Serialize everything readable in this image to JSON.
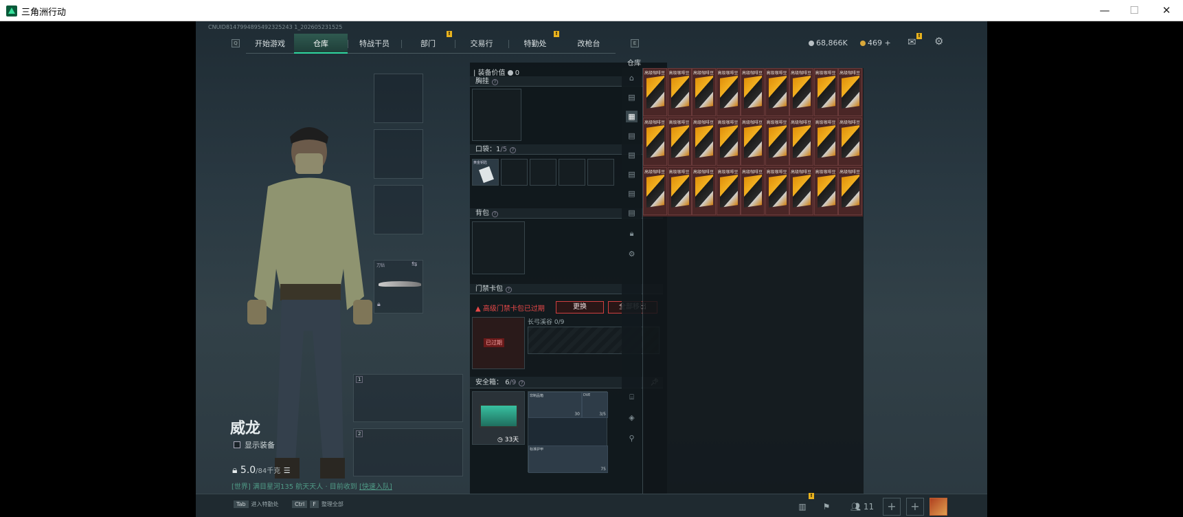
{
  "window": {
    "title": "三角洲行动",
    "minimize": "—",
    "maximize": "☐",
    "close": "✕"
  },
  "uid": "CNUID8147994895492325243 1_202605231525",
  "nav": {
    "left_key": "Q",
    "right_key": "E",
    "items": [
      {
        "label": "开始游戏",
        "active": false
      },
      {
        "label": "仓库",
        "active": true
      },
      {
        "label": "特战干员",
        "active": false
      },
      {
        "label": "部门",
        "active": false,
        "badge": "!"
      },
      {
        "label": "交易行",
        "active": false
      },
      {
        "label": "特勤处",
        "active": false,
        "badge": "!"
      },
      {
        "label": "改枪台",
        "active": false
      }
    ]
  },
  "currency": {
    "silver": "68,866K",
    "gold": "469",
    "plus": "+"
  },
  "character": {
    "name": "威龙",
    "show_gear": "显示装备",
    "weight": "5.0",
    "weight_max": "/84千克",
    "melee_label": "刀钻"
  },
  "chat": {
    "channel": "[世界]",
    "text": "满目星河135 航天天人 · 目前收到",
    "link": "[快速入队]"
  },
  "equipment": {
    "value_label": "装备价值",
    "value": "0",
    "chest": "胸挂",
    "pockets": "口袋：",
    "pockets_count": "1",
    "pockets_max": "/5",
    "pocket_item": "黄金钥匙",
    "backpack": "背包",
    "card_pack": "门禁卡包",
    "warning": "高级门禁卡包已过期",
    "replace": "更换",
    "remove_all": "全部移出",
    "expired_tag": "已过期",
    "long_card": "长弓溪谷 0/9",
    "safe_box": "安全箱：",
    "safe_count": "6",
    "safe_max": "/9",
    "safe_days": "33天",
    "safe_items": [
      {
        "label": "非制品箱",
        "count": "30"
      },
      {
        "label": "DVE",
        "count": "3/5"
      },
      {
        "label": "标准护甲",
        "count": "75"
      }
    ]
  },
  "storage": {
    "label": "仓库",
    "item_label": "高级咖啡豆",
    "rows": 3,
    "cols": 9
  },
  "bottom": {
    "hint1_key": "Tab",
    "hint1": "进入特勤处",
    "hint2_key": "Ctrl",
    "hint2_key2": "F",
    "hint2": "整理全部",
    "friends": "11"
  }
}
